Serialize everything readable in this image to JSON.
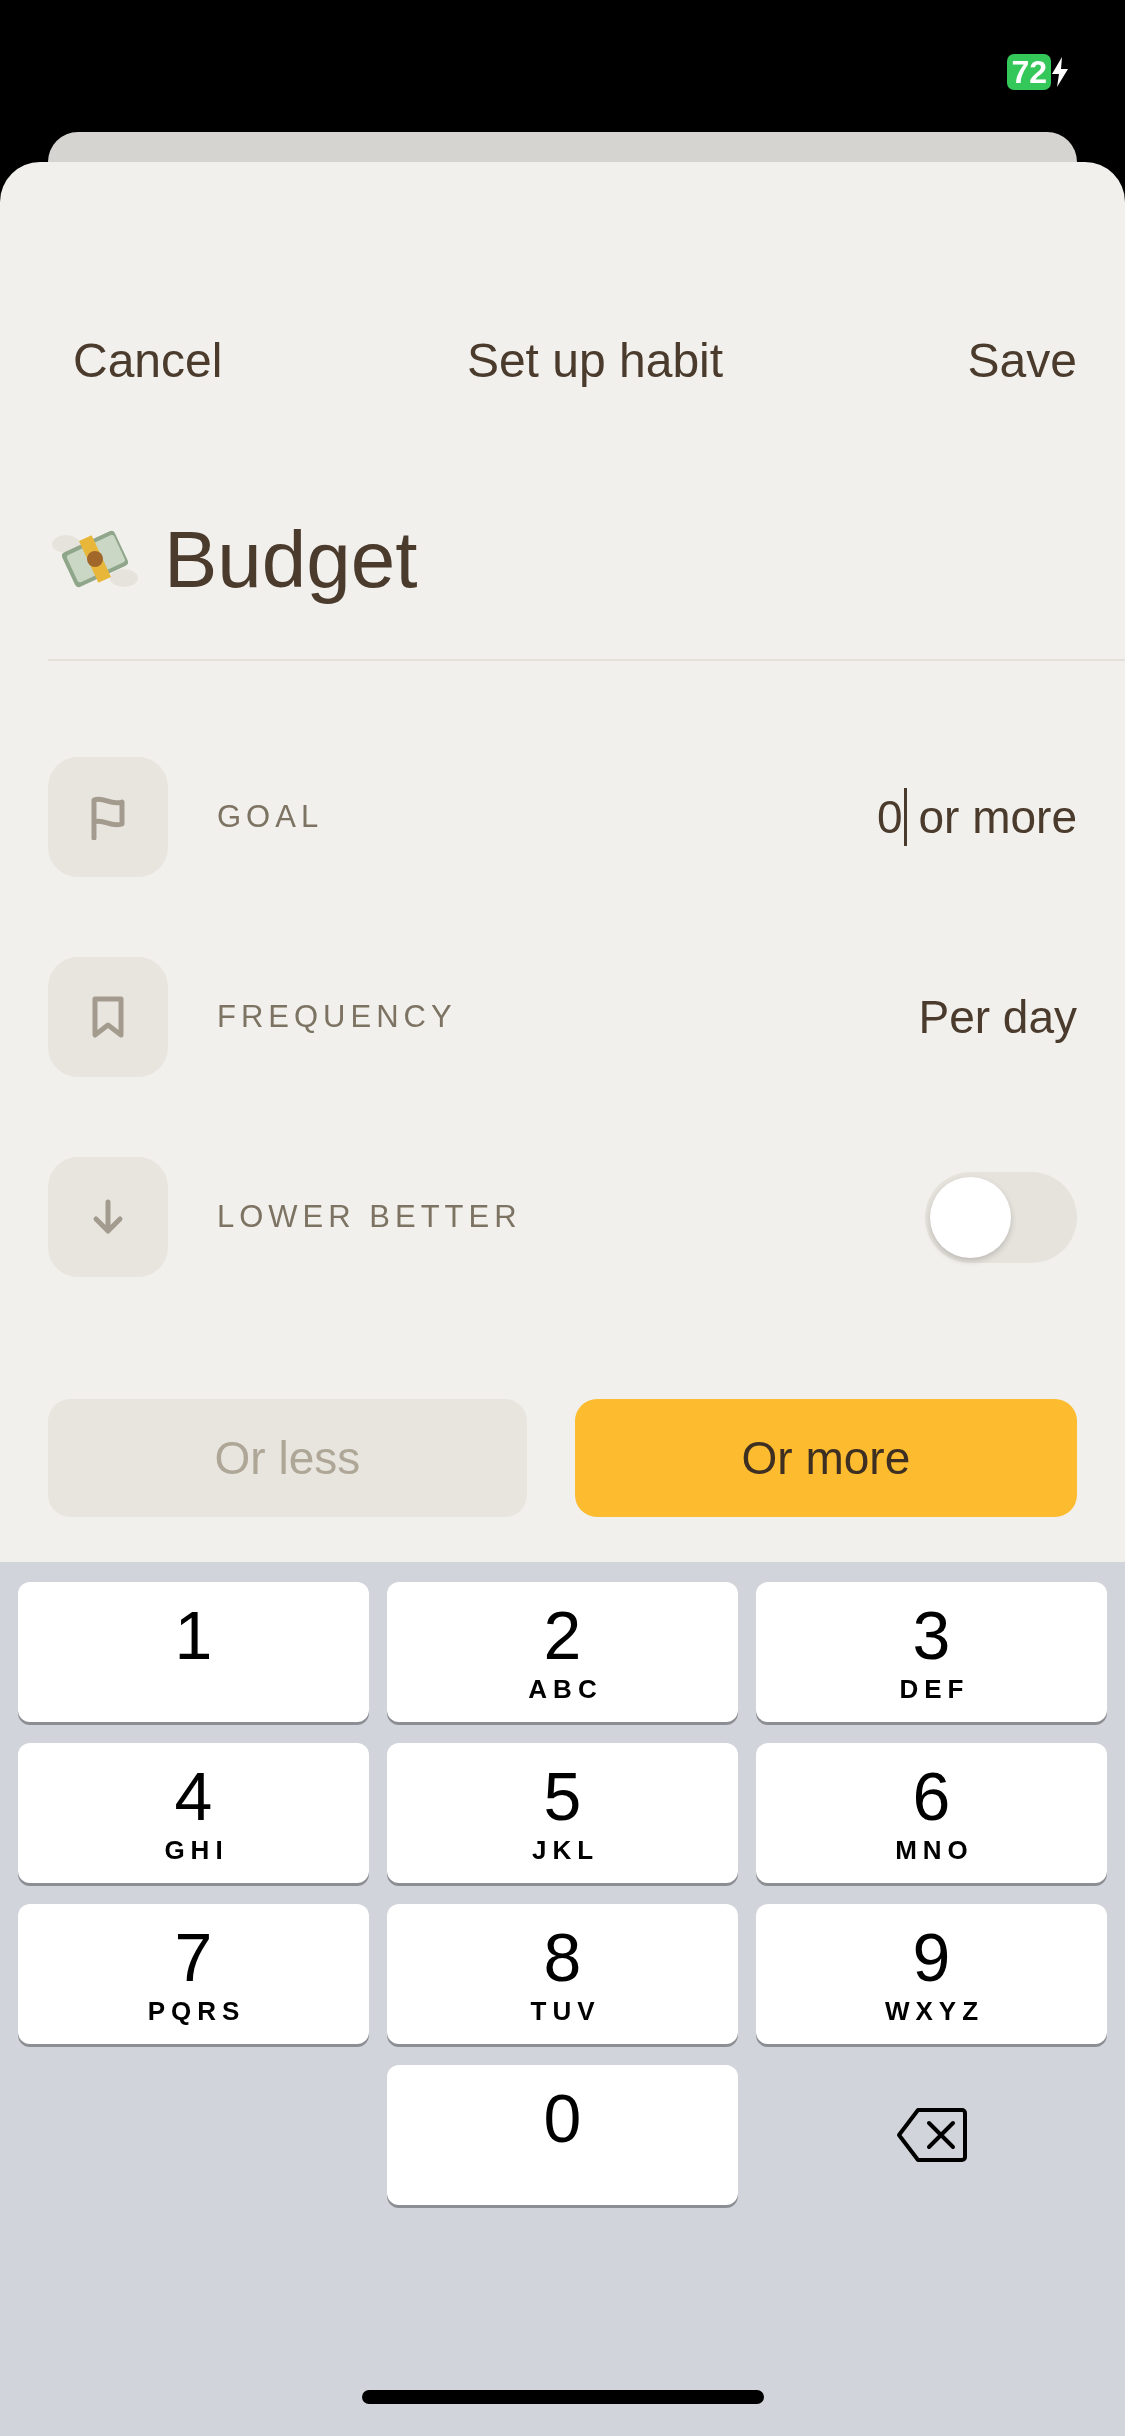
{
  "status_bar": {
    "battery": "72",
    "charging": true
  },
  "header": {
    "cancel": "Cancel",
    "title": "Set up habit",
    "save": "Save"
  },
  "habit": {
    "name": "Budget"
  },
  "rows": [
    {
      "kind": "goal",
      "label": "GOAL",
      "value": "0",
      "suffix": "or more"
    },
    {
      "kind": "frequency",
      "label": "FREQUENCY",
      "value": "Per day"
    },
    {
      "kind": "lower_better",
      "label": "LOWER BETTER",
      "on": false
    }
  ],
  "direction_options": [
    {
      "label": "Or less",
      "selected": false
    },
    {
      "label": "Or more",
      "selected": true
    }
  ],
  "keypad": [
    {
      "kind": "digit",
      "digit": "1"
    },
    {
      "kind": "digit",
      "digit": "2",
      "letters": "ABC"
    },
    {
      "kind": "digit",
      "digit": "3",
      "letters": "DEF"
    },
    {
      "kind": "digit",
      "digit": "4",
      "letters": "GHI"
    },
    {
      "kind": "digit",
      "digit": "5",
      "letters": "JKL"
    },
    {
      "kind": "digit",
      "digit": "6",
      "letters": "MNO"
    },
    {
      "kind": "digit",
      "digit": "7",
      "letters": "PQRS"
    },
    {
      "kind": "digit",
      "digit": "8",
      "letters": "TUV"
    },
    {
      "kind": "digit",
      "digit": "9",
      "letters": "WXYZ"
    },
    {
      "kind": "digit",
      "digit": "0"
    },
    {
      "kind": "delete"
    }
  ]
}
